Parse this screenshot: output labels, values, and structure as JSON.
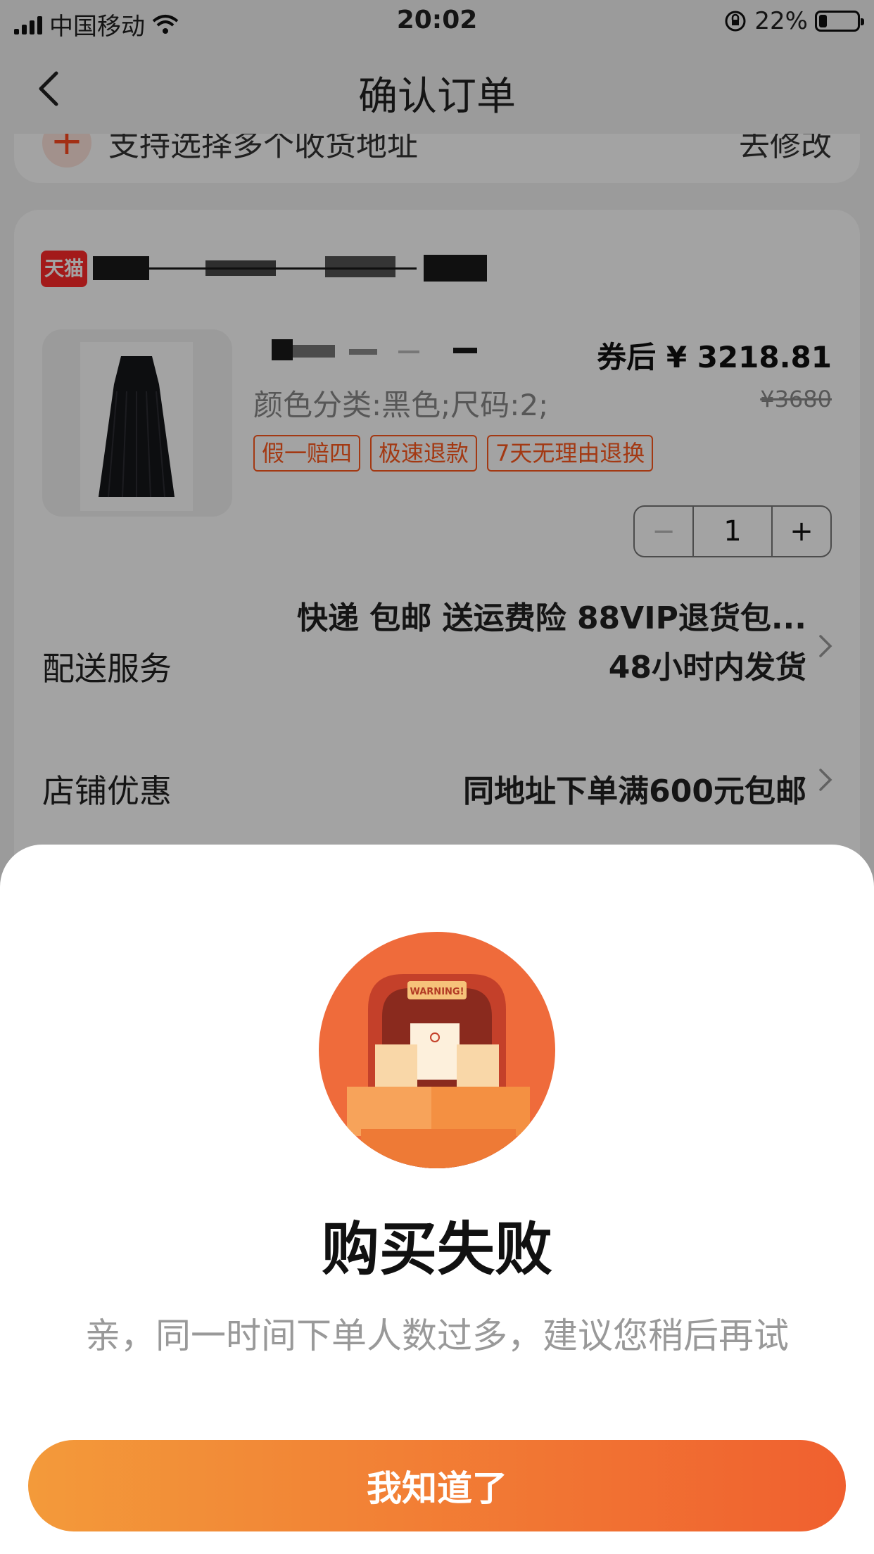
{
  "status_bar": {
    "carrier": "中国移动",
    "time": "20:02",
    "battery_text": "22%",
    "battery_level": 0.22,
    "icons": [
      "signal-icon",
      "wifi-icon",
      "rotation-lock-icon",
      "battery-icon"
    ]
  },
  "nav": {
    "title": "确认订单",
    "back_icon": "chevron-left-icon"
  },
  "address": {
    "text": "支持选择多个收货地址",
    "action": "去修改"
  },
  "order": {
    "shop_badge": "天猫",
    "price_after": "券后 ¥ 3218.81",
    "price_original": "¥3680",
    "sku": "颜色分类:黑色;尺码:2;",
    "tags": [
      "假一赔四",
      "极速退款",
      "7天无理由退换"
    ],
    "quantity": "1",
    "minus": "−",
    "plus": "+",
    "delivery_label": "配送服务",
    "delivery_value_line1": "快递 包邮 送运费险 88VIP退货包...",
    "delivery_value_line2": "48小时内发货",
    "discount_label": "店铺优惠",
    "discount_value": "同地址下单满600元包邮"
  },
  "dialog": {
    "illustration_text": "WARNING!",
    "title": "购买失败",
    "message": "亲，同一时间下单人数过多，建议您稍后再试",
    "button": "我知道了",
    "colors": {
      "button_start": "#f39a3a",
      "button_end": "#f0602f"
    }
  }
}
